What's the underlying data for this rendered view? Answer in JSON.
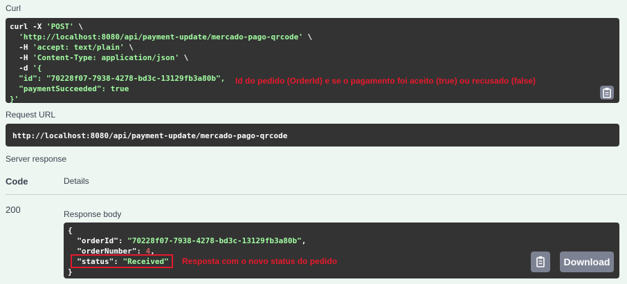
{
  "curl": {
    "title": "Curl",
    "lines": [
      [
        {
          "t": "curl -X ",
          "c": "w"
        },
        {
          "t": "'POST'",
          "c": "g"
        },
        {
          "t": " \\",
          "c": "w"
        }
      ],
      [
        {
          "t": "  ",
          "c": "w"
        },
        {
          "t": "'http://localhost:8080/api/payment-update/mercado-pago-qrcode'",
          "c": "g"
        },
        {
          "t": " \\",
          "c": "w"
        }
      ],
      [
        {
          "t": "  -H ",
          "c": "w"
        },
        {
          "t": "'accept: text/plain'",
          "c": "g"
        },
        {
          "t": " \\",
          "c": "w"
        }
      ],
      [
        {
          "t": "  -H ",
          "c": "w"
        },
        {
          "t": "'Content-Type: application/json'",
          "c": "g"
        },
        {
          "t": " \\",
          "c": "w"
        }
      ],
      [
        {
          "t": "  -d ",
          "c": "w"
        },
        {
          "t": "'{",
          "c": "g"
        }
      ],
      [
        {
          "t": "  \"id\": \"70228f07-7938-4278-bd3c-13129fb3a80b\",",
          "c": "g"
        }
      ],
      [
        {
          "t": "  \"paymentSucceeded\": true",
          "c": "g"
        }
      ],
      [
        {
          "t": "}'",
          "c": "g"
        }
      ]
    ],
    "annotation": "Id do pedido (OrderId) e se o pagamento foi aceito (true) ou recusado (false)"
  },
  "request_url": {
    "title": "Request URL",
    "value": "http://localhost:8080/api/payment-update/mercado-pago-qrcode"
  },
  "server_response": {
    "title": "Server response",
    "col_code": "Code",
    "col_details": "Details",
    "code": "200",
    "body_title": "Response body",
    "body_lines": [
      [
        {
          "t": "{",
          "c": "w"
        }
      ],
      [
        {
          "t": "  \"orderId\": ",
          "c": "w"
        },
        {
          "t": "\"70228f07-7938-4278-bd3c-13129fb3a80b\"",
          "c": "g"
        },
        {
          "t": ",",
          "c": "w"
        }
      ],
      [
        {
          "t": "  \"orderNumber\": ",
          "c": "w"
        },
        {
          "t": "4",
          "c": "p"
        },
        {
          "t": ",",
          "c": "w"
        }
      ],
      [
        {
          "t": "  \"status\": ",
          "c": "w"
        },
        {
          "t": "\"Received\"",
          "c": "g"
        }
      ],
      [
        {
          "t": "}",
          "c": "w"
        }
      ]
    ],
    "annotation": "Resposta com o novo status do pedido",
    "download_label": "Download"
  },
  "icons": {
    "copy": "clipboard-icon"
  },
  "colors": {
    "background": "#edf6f0",
    "code_background": "#333333",
    "string": "#a2fca2",
    "number": "#d36363",
    "annotation": "#e8192c",
    "button": "#7d8293"
  }
}
